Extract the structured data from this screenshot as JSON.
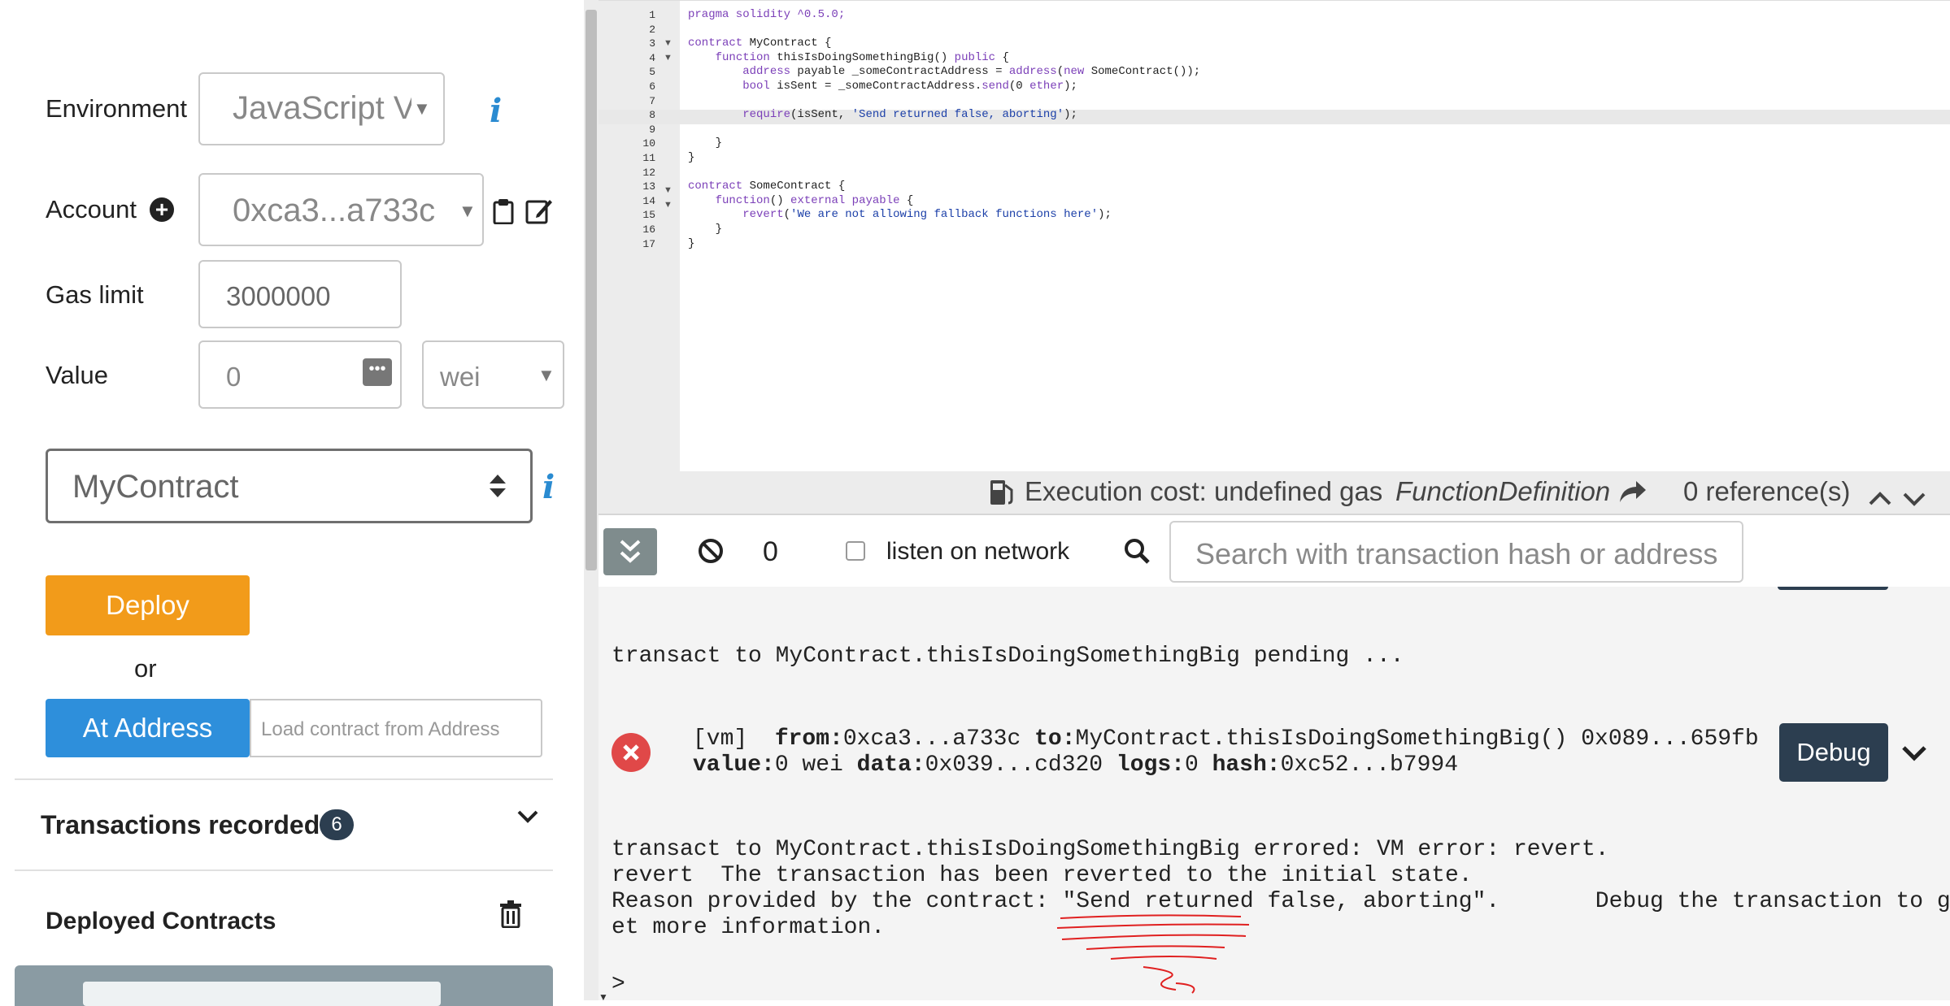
{
  "run_panel": {
    "environment_label": "Environment",
    "environment_value": "JavaScript VM",
    "account_label": "Account",
    "account_value": "0xca3...a733c",
    "gas_limit_label": "Gas limit",
    "gas_limit_value": "3000000",
    "value_label": "Value",
    "value_amount": "0",
    "value_unit": "wei",
    "contract_select": "MyContract",
    "deploy_label": "Deploy",
    "or_label": "or",
    "at_address_label": "At Address",
    "at_address_placeholder": "Load contract from Address",
    "transactions_recorded_label": "Transactions recorded:",
    "transactions_recorded_count": "6",
    "deployed_contracts_label": "Deployed Contracts"
  },
  "editor": {
    "line_numbers": [
      "1",
      "2",
      "3",
      "4",
      "5",
      "6",
      "7",
      "8",
      "9",
      "10",
      "11",
      "12",
      "13",
      "14",
      "15",
      "16",
      "17"
    ],
    "lines": {
      "l1": "pragma solidity ^0.5.0;",
      "l3a": "contract",
      "l3b": " MyContract {",
      "l4a": "function",
      "l4b": " thisIsDoingSomethingBig() ",
      "l4c": "public",
      "l4d": " {",
      "l5a": "address",
      "l5b": " payable",
      "l5c": " _someContractAddress = ",
      "l5d": "address",
      "l5e": "(",
      "l5f": "new",
      "l5g": " SomeContract());",
      "l6a": "bool",
      "l6b": " isSent = _someContractAddress.",
      "l6c": "send",
      "l6d": "(0 ",
      "l6e": "ether",
      "l6f": ");",
      "l8a": "require",
      "l8b": "(isSent, ",
      "l8c": "'Send returned false, aborting'",
      "l8d": ");",
      "l10": "}",
      "l11": "}",
      "l13a": "contract",
      "l13b": " SomeContract {",
      "l14a": "function",
      "l14b": "() ",
      "l14c": "external",
      "l14d": " payable",
      "l14e": " {",
      "l15a": "revert",
      "l15b": "(",
      "l15c": "'We are not allowing fallback functions here'",
      "l15d": ");",
      "l16": "}",
      "l17": "}"
    }
  },
  "statusbar": {
    "execution_cost": "Execution cost: undefined gas",
    "function_definition": "FunctionDefinition",
    "references": "0 reference(s)"
  },
  "terminal_bar": {
    "pending_count": "0",
    "listen_label": "listen on network",
    "search_placeholder": "Search with transaction hash or address"
  },
  "terminal": {
    "pending_line": "transact to MyContract.thisIsDoingSomethingBig pending ...",
    "tx": {
      "vm": "[vm]",
      "from_label": "from:",
      "from_value": "0xca3...a733c",
      "to_label": "to:",
      "to_value": "MyContract.thisIsDoingSomethingBig() 0x089...659fb",
      "value_label": "value:",
      "value_value": "0 wei",
      "data_label": "data:",
      "data_value": "0x039...cd320",
      "logs_label": "logs:",
      "logs_value": "0",
      "hash_label": "hash:",
      "hash_value": "0xc52...b7994",
      "debug_label": "Debug"
    },
    "error_line1": "transact to MyContract.thisIsDoingSomethingBig errored: VM error: revert.",
    "error_line2": "revert  The transaction has been reverted to the initial state.",
    "error_line3": "Reason provided by the contract: \"Send returned false, aborting\".       Debug the transaction to g",
    "error_line4": "et more information.",
    "prompt": ">"
  },
  "colors": {
    "deploy": "#f29b1a",
    "at_address": "#2e8fdb",
    "debug_button": "#2c3e50",
    "error_icon": "#e04848",
    "badge": "#2c3e50"
  }
}
